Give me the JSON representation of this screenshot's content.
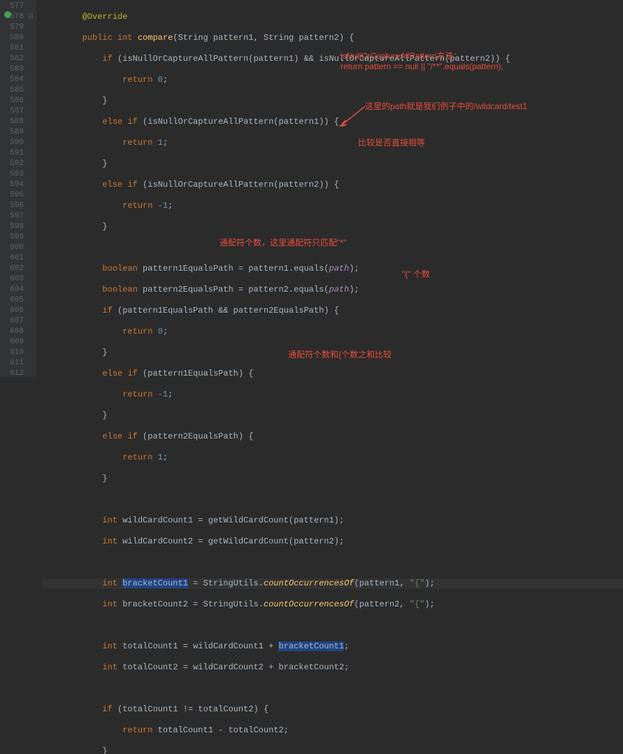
{
  "lines": {
    "start": 577,
    "end": 612
  },
  "annotations": {
    "a1_line1": "isNullOrCaptureAllPattern方法：",
    "a1_line2": "return pattern == null || \"/**\".equals(pattern);",
    "a2": "这里的path就是我们例子中的/wildcard/test1",
    "a3": "比较是否直接相等",
    "a4": "通配符个数，这里通配符只匹配\"*\"",
    "a5": "\"{\" 个数",
    "a6": "通配符个数和{个数之和比较"
  },
  "code": {
    "l577": "@Override",
    "l578_kw1": "public",
    "l578_kw2": "int",
    "l578_m": "compare",
    "l578_rest": "(String pattern1, String pattern2) {",
    "l579_kw": "if",
    "l579_c": " (isNullOrCaptureAllPattern(pattern1) && isNullOrCaptureAllPattern(pattern2)) {",
    "l580_kw": "return",
    "l580_v": "0",
    "l580_s": ";",
    "l581": "}",
    "l582_kw1": "else",
    "l582_kw2": "if",
    "l582_c": " (isNullOrCaptureAllPattern(pattern1)) {",
    "l583_kw": "return",
    "l583_v": "1",
    "l583_s": ";",
    "l584": "}",
    "l585_kw1": "else",
    "l585_kw2": "if",
    "l585_c": " (isNullOrCaptureAllPattern(pattern2)) {",
    "l586_kw": "return",
    "l586_v": "-1",
    "l586_s": ";",
    "l587": "}",
    "l589_kw": "boolean",
    "l589_c1": " pattern1EqualsPath = pattern1.equals(",
    "l589_p": "path",
    "l589_c2": ");",
    "l590_kw": "boolean",
    "l590_c1": " pattern2EqualsPath = pattern2.equals(",
    "l590_p": "path",
    "l590_c2": ");",
    "l591_kw": "if",
    "l591_c": " (pattern1EqualsPath && pattern2EqualsPath) {",
    "l592_kw": "return",
    "l592_v": "0",
    "l592_s": ";",
    "l593": "}",
    "l594_kw1": "else",
    "l594_kw2": "if",
    "l594_c": " (pattern1EqualsPath) {",
    "l595_kw": "return",
    "l595_v": "-1",
    "l595_s": ";",
    "l596": "}",
    "l597_kw1": "else",
    "l597_kw2": "if",
    "l597_c": " (pattern2EqualsPath) {",
    "l598_kw": "return",
    "l598_v": "1",
    "l598_s": ";",
    "l599": "}",
    "l601_kw": "int",
    "l601_c": " wildCardCount1 = getWildCardCount(pattern1);",
    "l602_kw": "int",
    "l602_c": " wildCardCount2 = getWildCardCount(pattern2);",
    "l604_kw": "int",
    "l604_v": "bracketCount1",
    "l604_c1": " = StringUtils.",
    "l604_m": "countOccurrencesOf",
    "l604_c2": "(pattern1, ",
    "l604_s": "\"{\"",
    "l604_c3": ");",
    "l605_kw": "int",
    "l605_c1": " bracketCount2 = StringUtils.",
    "l605_m": "countOccurrencesOf",
    "l605_c2": "(pattern2, ",
    "l605_s": "\"{\"",
    "l605_c3": ");",
    "l607_kw": "int",
    "l607_c1": " totalCount1 = wildCardCount1 + ",
    "l607_v": "bracketCount1",
    "l607_c2": ";",
    "l608_kw": "int",
    "l608_c": " totalCount2 = wildCardCount2 + bracketCount2;",
    "l610_kw": "if",
    "l610_c": " (totalCount1 != totalCount2) {",
    "l611_kw": "return",
    "l611_c": " totalCount1 - totalCount2;",
    "l612": "}"
  }
}
